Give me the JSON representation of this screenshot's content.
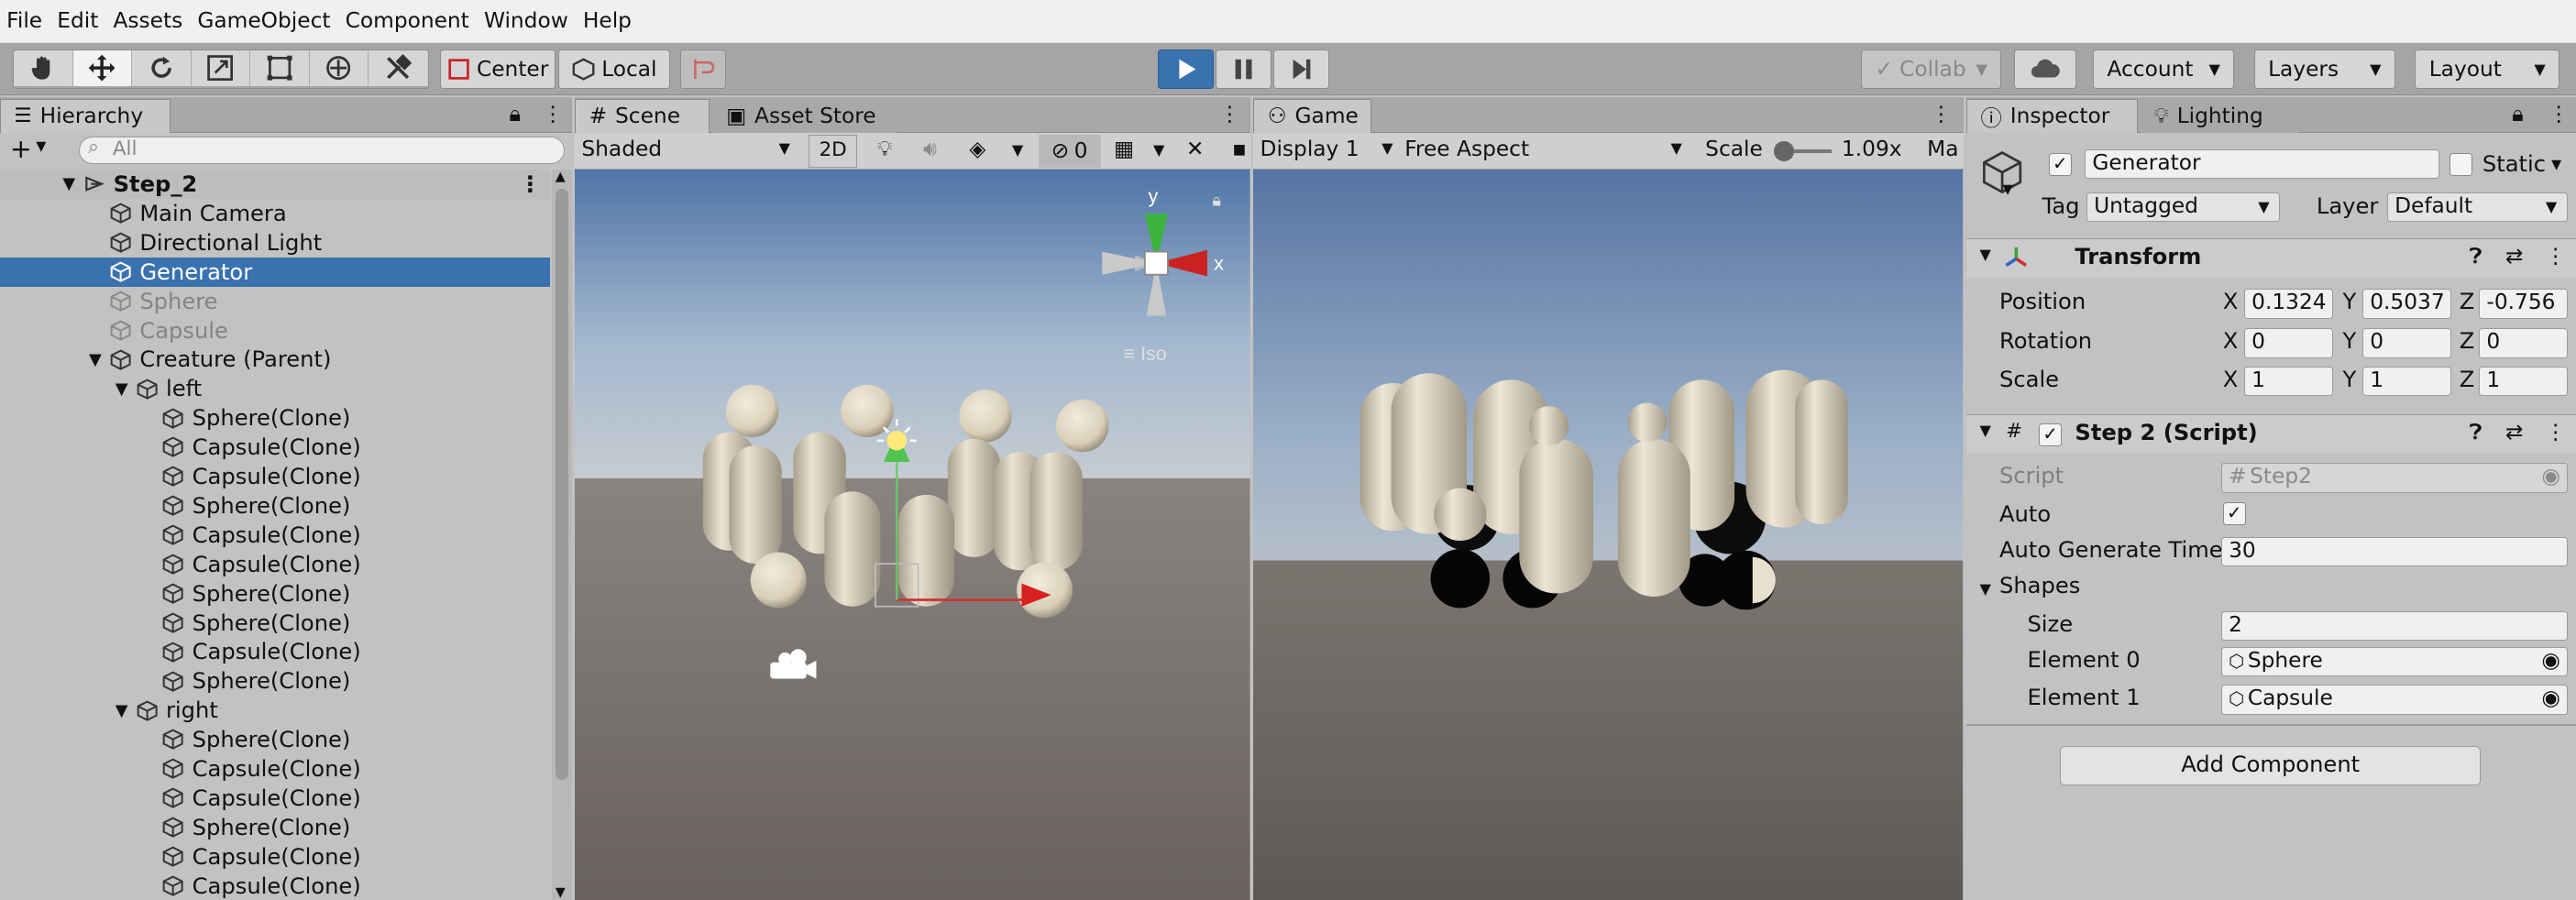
{
  "menu": [
    "File",
    "Edit",
    "Assets",
    "GameObject",
    "Component",
    "Window",
    "Help"
  ],
  "toolbar": {
    "pivot": "Center",
    "space": "Local",
    "collab": "Collab",
    "account": "Account",
    "layers": "Layers",
    "layout": "Layout"
  },
  "hierarchy": {
    "tab": "Hierarchy",
    "add": "+",
    "search_placeholder": "All",
    "scene": "Step_2",
    "items": [
      {
        "label": "Main Camera",
        "depth": 1,
        "fold": "",
        "dim": false,
        "sel": false
      },
      {
        "label": "Directional Light",
        "depth": 1,
        "fold": "",
        "dim": false,
        "sel": false
      },
      {
        "label": "Generator",
        "depth": 1,
        "fold": "",
        "dim": false,
        "sel": true
      },
      {
        "label": "Sphere",
        "depth": 1,
        "fold": "",
        "dim": true,
        "sel": false
      },
      {
        "label": "Capsule",
        "depth": 1,
        "fold": "",
        "dim": true,
        "sel": false
      },
      {
        "label": "Creature (Parent)",
        "depth": 1,
        "fold": "▼",
        "dim": false,
        "sel": false
      },
      {
        "label": "left",
        "depth": 2,
        "fold": "▼",
        "dim": false,
        "sel": false
      },
      {
        "label": "Sphere(Clone)",
        "depth": 3,
        "fold": "",
        "dim": false,
        "sel": false
      },
      {
        "label": "Capsule(Clone)",
        "depth": 3,
        "fold": "",
        "dim": false,
        "sel": false
      },
      {
        "label": "Capsule(Clone)",
        "depth": 3,
        "fold": "",
        "dim": false,
        "sel": false
      },
      {
        "label": "Sphere(Clone)",
        "depth": 3,
        "fold": "",
        "dim": false,
        "sel": false
      },
      {
        "label": "Capsule(Clone)",
        "depth": 3,
        "fold": "",
        "dim": false,
        "sel": false
      },
      {
        "label": "Capsule(Clone)",
        "depth": 3,
        "fold": "",
        "dim": false,
        "sel": false
      },
      {
        "label": "Sphere(Clone)",
        "depth": 3,
        "fold": "",
        "dim": false,
        "sel": false
      },
      {
        "label": "Sphere(Clone)",
        "depth": 3,
        "fold": "",
        "dim": false,
        "sel": false
      },
      {
        "label": "Capsule(Clone)",
        "depth": 3,
        "fold": "",
        "dim": false,
        "sel": false
      },
      {
        "label": "Sphere(Clone)",
        "depth": 3,
        "fold": "",
        "dim": false,
        "sel": false
      },
      {
        "label": "right",
        "depth": 2,
        "fold": "▼",
        "dim": false,
        "sel": false
      },
      {
        "label": "Sphere(Clone)",
        "depth": 3,
        "fold": "",
        "dim": false,
        "sel": false
      },
      {
        "label": "Capsule(Clone)",
        "depth": 3,
        "fold": "",
        "dim": false,
        "sel": false
      },
      {
        "label": "Capsule(Clone)",
        "depth": 3,
        "fold": "",
        "dim": false,
        "sel": false
      },
      {
        "label": "Sphere(Clone)",
        "depth": 3,
        "fold": "",
        "dim": false,
        "sel": false
      },
      {
        "label": "Capsule(Clone)",
        "depth": 3,
        "fold": "",
        "dim": false,
        "sel": false
      },
      {
        "label": "Capsule(Clone)",
        "depth": 3,
        "fold": "",
        "dim": false,
        "sel": false
      }
    ]
  },
  "scene": {
    "tab": "Scene",
    "tab2": "Asset Store",
    "shading": "Shaded",
    "mode2d": "2D",
    "hidden_count": "0",
    "gizmo_y": "y",
    "gizmo_x": "x",
    "iso": "Iso"
  },
  "game": {
    "tab": "Game",
    "display": "Display 1",
    "aspect": "Free Aspect",
    "scale_label": "Scale",
    "scale_value": "1.09x",
    "maximize": "Ma"
  },
  "inspector": {
    "tab": "Inspector",
    "tab2": "Lighting",
    "object_name": "Generator",
    "static": "Static",
    "tag_label": "Tag",
    "tag": "Untagged",
    "layer_label": "Layer",
    "layer": "Default",
    "transform": {
      "title": "Transform",
      "position_label": "Position",
      "rotation_label": "Rotation",
      "scale_label": "Scale",
      "x": "X",
      "y": "Y",
      "z": "Z",
      "position": [
        "0.1324",
        "0.5037",
        "-0.756"
      ],
      "rotation": [
        "0",
        "0",
        "0"
      ],
      "scale": [
        "1",
        "1",
        "1"
      ]
    },
    "script": {
      "title": "Step 2 (Script)",
      "script_label": "Script",
      "script_value": "Step2",
      "auto_label": "Auto",
      "auto_time_label": "Auto Generate Time",
      "auto_time": "30",
      "shapes_label": "Shapes",
      "size_label": "Size",
      "size": "2",
      "element0_label": "Element 0",
      "element0": "Sphere",
      "element1_label": "Element 1",
      "element1": "Capsule"
    },
    "add_component": "Add Component"
  },
  "colors": {
    "selection": "#3a72b0",
    "panel_bg": "#c2c2c2",
    "play_active": "#3a72b0",
    "shape": "#e3dac5"
  }
}
